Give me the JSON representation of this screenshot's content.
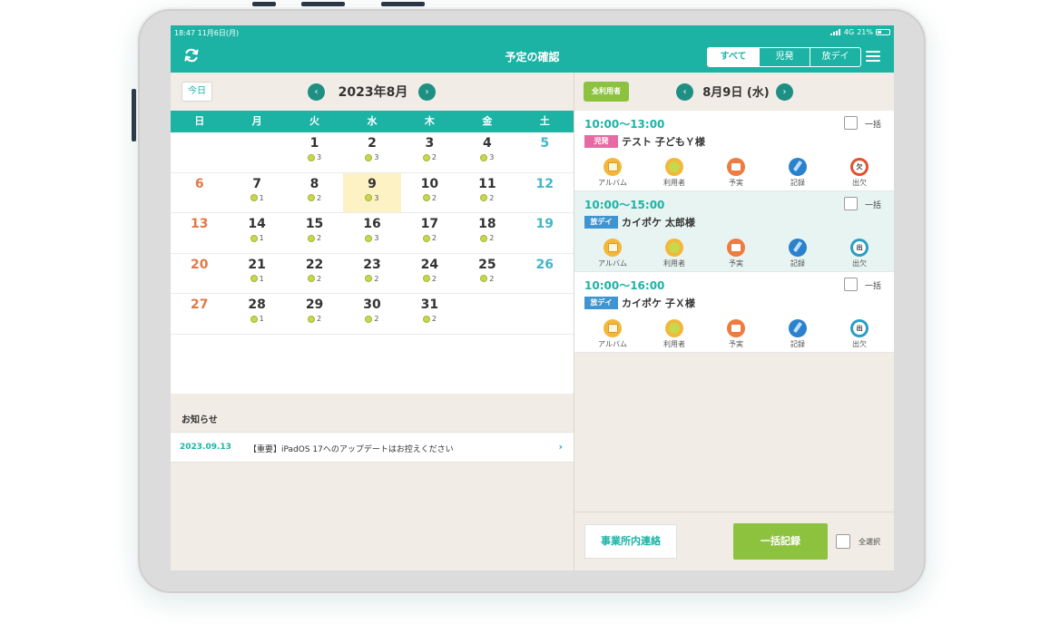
{
  "status": {
    "time": "18:47 11月6日(月)",
    "network": "4G",
    "battery": "21%"
  },
  "header": {
    "title": "予定の確認",
    "filters": [
      "すべて",
      "児発",
      "放デイ"
    ],
    "active_filter": "すべて"
  },
  "calendar": {
    "today_label": "今日",
    "prev_label": "‹",
    "next_label": "›",
    "month_title": "2023年8月",
    "weekdays": [
      "日",
      "月",
      "火",
      "水",
      "木",
      "金",
      "土"
    ],
    "weeks": [
      [
        {
          "d": ""
        },
        {
          "d": ""
        },
        {
          "d": "1",
          "c": "3"
        },
        {
          "d": "2",
          "c": "3"
        },
        {
          "d": "3",
          "c": "2"
        },
        {
          "d": "4",
          "c": "3"
        },
        {
          "d": "5"
        }
      ],
      [
        {
          "d": "6"
        },
        {
          "d": "7",
          "c": "1"
        },
        {
          "d": "8",
          "c": "2"
        },
        {
          "d": "9",
          "c": "3",
          "selected": true
        },
        {
          "d": "10",
          "c": "2"
        },
        {
          "d": "11",
          "c": "2"
        },
        {
          "d": "12"
        }
      ],
      [
        {
          "d": "13"
        },
        {
          "d": "14",
          "c": "1"
        },
        {
          "d": "15",
          "c": "2"
        },
        {
          "d": "16",
          "c": "3"
        },
        {
          "d": "17",
          "c": "2"
        },
        {
          "d": "18",
          "c": "2"
        },
        {
          "d": "19"
        }
      ],
      [
        {
          "d": "20"
        },
        {
          "d": "21",
          "c": "1"
        },
        {
          "d": "22",
          "c": "2"
        },
        {
          "d": "23",
          "c": "2"
        },
        {
          "d": "24",
          "c": "2"
        },
        {
          "d": "25",
          "c": "2"
        },
        {
          "d": "26"
        }
      ],
      [
        {
          "d": "27"
        },
        {
          "d": "28",
          "c": "1"
        },
        {
          "d": "29",
          "c": "2"
        },
        {
          "d": "30",
          "c": "2"
        },
        {
          "d": "31",
          "c": "2"
        },
        {
          "d": ""
        },
        {
          "d": ""
        }
      ]
    ]
  },
  "notice": {
    "label": "お知らせ",
    "date": "2023.09.13",
    "text": "【重要】iPadOS 17へのアップデートはお控えください",
    "chevron": "›"
  },
  "schedule": {
    "all_users_label": "全利用者",
    "prev_label": "‹",
    "next_label": "›",
    "date_title": "8月9日 (水)",
    "bulk_label": "一括",
    "items": [
      {
        "time": "10:00〜13:00",
        "tag": "児発",
        "name": "テスト 子どもＹ様"
      },
      {
        "time": "10:00〜15:00",
        "tag": "放デイ",
        "name": "カイポケ 太郎様"
      },
      {
        "time": "10:00〜16:00",
        "tag": "放デイ",
        "name": "カイポケ 子Ｘ様"
      }
    ],
    "action_labels": [
      "アルバム",
      "利用者",
      "予実",
      "記録",
      "出欠"
    ],
    "attend_glyph": "欠",
    "attend_glyph_present": "出"
  },
  "bottom": {
    "office_contact_label": "事業所内連絡",
    "bulk_record_label": "一括記録",
    "select_all_label": "全選択"
  },
  "colors": {
    "primary": "#1cb3a5",
    "accent_green": "#8dc23e",
    "tag_pink": "#e66aa3",
    "tag_blue": "#3f95d1",
    "sunday": "#e07a44",
    "saturday": "#43b6c8",
    "selected_day": "#fcf2c4"
  }
}
